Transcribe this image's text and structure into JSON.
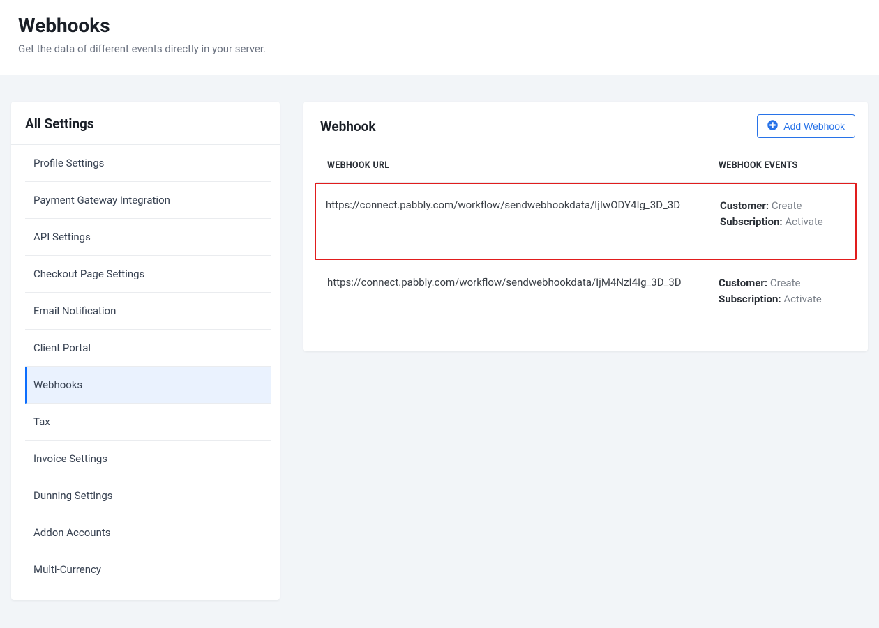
{
  "header": {
    "title": "Webhooks",
    "subtitle": "Get the data of different events directly in your server."
  },
  "sidebar": {
    "title": "All Settings",
    "items": [
      {
        "label": "Profile Settings",
        "active": false
      },
      {
        "label": "Payment Gateway Integration",
        "active": false
      },
      {
        "label": "API Settings",
        "active": false
      },
      {
        "label": "Checkout Page Settings",
        "active": false
      },
      {
        "label": "Email Notification",
        "active": false
      },
      {
        "label": "Client Portal",
        "active": false
      },
      {
        "label": "Webhooks",
        "active": true
      },
      {
        "label": "Tax",
        "active": false
      },
      {
        "label": "Invoice Settings",
        "active": false
      },
      {
        "label": "Dunning Settings",
        "active": false
      },
      {
        "label": "Addon Accounts",
        "active": false
      },
      {
        "label": "Multi-Currency",
        "active": false
      }
    ]
  },
  "main": {
    "title": "Webhook",
    "add_button": "Add Webhook",
    "columns": {
      "url": "WEBHOOK URL",
      "events": "WEBHOOK EVENTS"
    },
    "event_labels": {
      "customer": "Customer:",
      "subscription": "Subscription:"
    },
    "rows": [
      {
        "url": "https://connect.pabbly.com/workflow/sendwebhookdata/IjIwODY4Ig_3D_3D",
        "customer_value": "Create",
        "subscription_value": "Activate",
        "highlight": true
      },
      {
        "url": "https://connect.pabbly.com/workflow/sendwebhookdata/IjM4NzI4Ig_3D_3D",
        "customer_value": "Create",
        "subscription_value": "Activate",
        "highlight": false
      }
    ]
  }
}
